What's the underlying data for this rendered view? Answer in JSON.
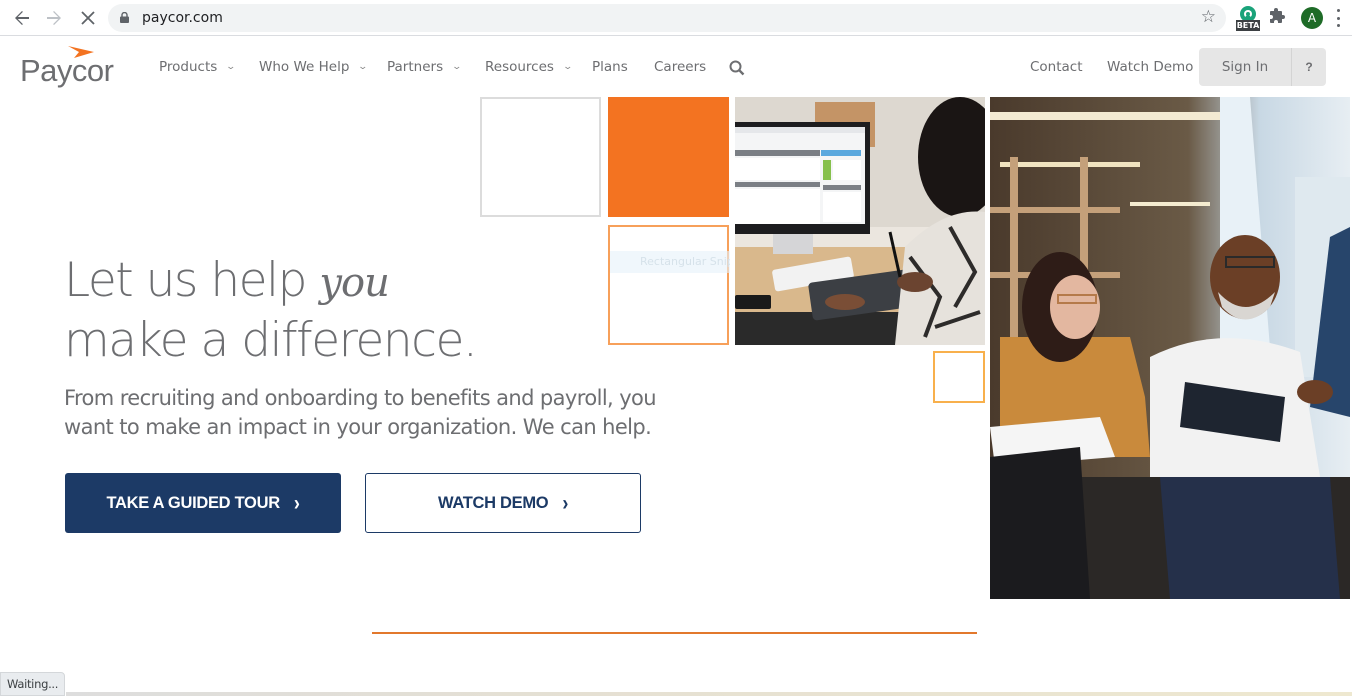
{
  "browser": {
    "url": "paycor.com",
    "extension_badge": "BETA",
    "profile_initial": "A",
    "icons": [
      "back-arrow-icon",
      "forward-arrow-icon",
      "stop-loading-icon",
      "lock-icon",
      "bookmark-star-icon",
      "extension-beta-icon",
      "extensions-puzzle-icon",
      "profile-avatar",
      "menu-kebab-icon"
    ]
  },
  "header": {
    "logo": "Paycor",
    "nav": [
      {
        "label": "Products",
        "has_dropdown": true
      },
      {
        "label": "Who We Help",
        "has_dropdown": true
      },
      {
        "label": "Partners",
        "has_dropdown": true
      },
      {
        "label": "Resources",
        "has_dropdown": true
      },
      {
        "label": "Plans",
        "has_dropdown": false
      },
      {
        "label": "Careers",
        "has_dropdown": false
      }
    ],
    "right_links": {
      "contact": "Contact",
      "watch_demo": "Watch Demo",
      "sign_in": "Sign In",
      "help": "?"
    }
  },
  "hero": {
    "title_line1": "Let us help",
    "title_script": "you",
    "title_line2": "make a difference.",
    "subtitle": "From recruiting and onboarding to benefits and payroll, you want to make an impact in your organization. We can help.",
    "primary_cta": "TAKE A GUIDED TOUR",
    "secondary_cta": "WATCH DEMO",
    "ghost_overlay": "Rectangular Snip"
  },
  "colors": {
    "brand_orange": "#f37321",
    "brand_navy": "#1c3a66",
    "text_gray": "#6d6e71"
  },
  "status_bar": "Waiting..."
}
